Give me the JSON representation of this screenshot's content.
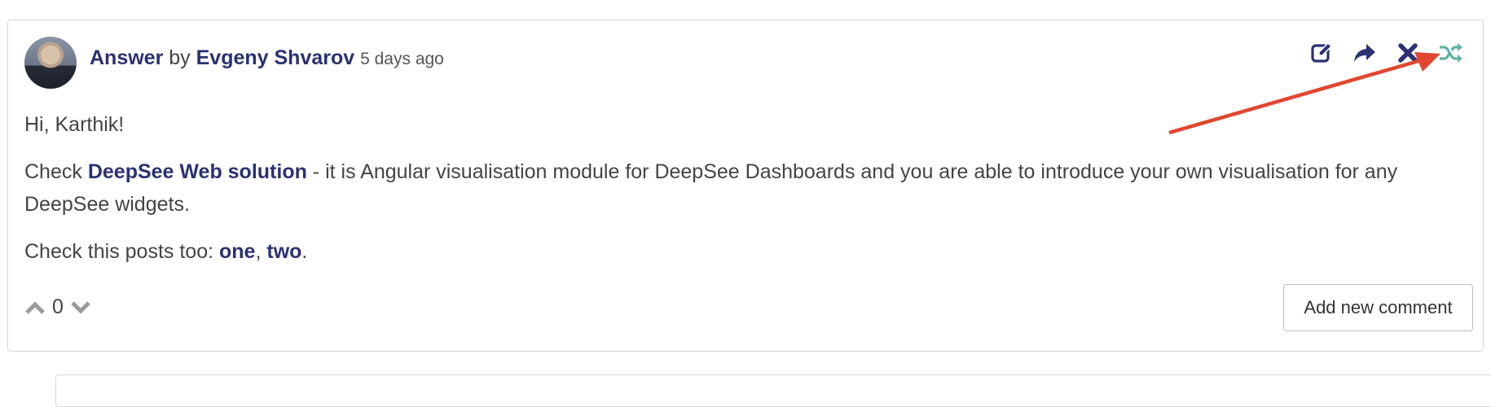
{
  "comment": {
    "type_label": "Answer",
    "by": "by",
    "author": "Evgeny Shvarov",
    "time": "5 days ago",
    "body": {
      "greeting": "Hi, Karthik!",
      "p2_pre": "Check",
      "p2_link": "DeepSee Web solution",
      "p2_post": " - it is Angular visualisation module for DeepSee Dashboards and you are able to introduce your own visualisation for any DeepSee widgets.",
      "p3_pre": "Check this posts too: ",
      "p3_link1": "one",
      "p3_sep": ", ",
      "p3_link2": "two",
      "p3_end": "."
    },
    "votes": "0",
    "add_comment_label": "Add new comment"
  },
  "actions": [
    {
      "icon": "edit-icon"
    },
    {
      "icon": "share-icon"
    },
    {
      "icon": "close-icon"
    },
    {
      "icon": "shuffle-icon"
    }
  ],
  "colors": {
    "link": "#2b3172",
    "action_icon": "#2b3172",
    "shuffle_icon": "#5fb3a6",
    "annotation_arrow": "#e2462f",
    "border": "#d6d6d6"
  }
}
